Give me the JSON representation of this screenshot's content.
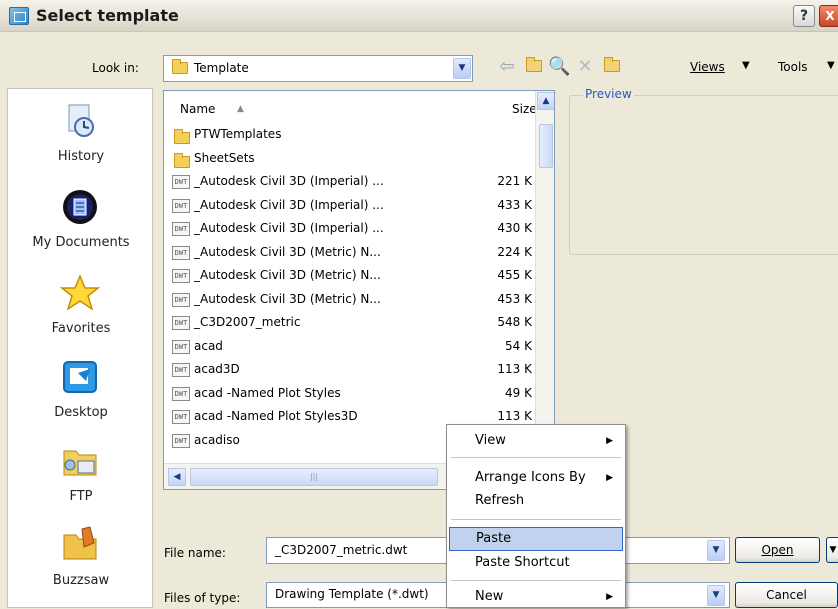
{
  "window": {
    "title": "Select template",
    "help_label": "?",
    "close_label": "X"
  },
  "lookin": {
    "label": "Look in:",
    "value": "Template"
  },
  "toolbar": {
    "views_label": "Views",
    "tools_label": "Tools"
  },
  "places": [
    {
      "label": "History",
      "icon": "history-icon"
    },
    {
      "label": "My Documents",
      "icon": "my-documents-icon"
    },
    {
      "label": "Favorites",
      "icon": "favorites-icon"
    },
    {
      "label": "Desktop",
      "icon": "desktop-icon"
    },
    {
      "label": "FTP",
      "icon": "ftp-icon"
    },
    {
      "label": "Buzzsaw",
      "icon": "buzzsaw-icon"
    }
  ],
  "filelist": {
    "columns": {
      "name": "Name",
      "size": "Size"
    },
    "items": [
      {
        "type": "folder",
        "name": "PTWTemplates",
        "size": ""
      },
      {
        "type": "folder",
        "name": "SheetSets",
        "size": ""
      },
      {
        "type": "dwt",
        "name": "_Autodesk Civil 3D (Imperial) ...",
        "size": "221 K"
      },
      {
        "type": "dwt",
        "name": "_Autodesk Civil 3D (Imperial) ...",
        "size": "433 K"
      },
      {
        "type": "dwt",
        "name": "_Autodesk Civil 3D (Imperial) ...",
        "size": "430 K"
      },
      {
        "type": "dwt",
        "name": "_Autodesk Civil 3D (Metric) N...",
        "size": "224 K"
      },
      {
        "type": "dwt",
        "name": "_Autodesk Civil 3D (Metric) N...",
        "size": "455 K"
      },
      {
        "type": "dwt",
        "name": "_Autodesk Civil 3D (Metric) N...",
        "size": "453 K"
      },
      {
        "type": "dwt",
        "name": "_C3D2007_metric",
        "size": "548 K"
      },
      {
        "type": "dwt",
        "name": "acad",
        "size": "54 K"
      },
      {
        "type": "dwt",
        "name": "acad3D",
        "size": "113 K"
      },
      {
        "type": "dwt",
        "name": "acad -Named Plot Styles",
        "size": "49 K"
      },
      {
        "type": "dwt",
        "name": "acad -Named Plot Styles3D",
        "size": "113 K"
      },
      {
        "type": "dwt",
        "name": "acadiso",
        "size": ""
      }
    ],
    "dwt_badge": "DWT"
  },
  "preview": {
    "label": "Preview"
  },
  "filename": {
    "label": "File name:",
    "value": "_C3D2007_metric.dwt"
  },
  "filetype": {
    "label": "Files of type:",
    "value": "Drawing Template (*.dwt)"
  },
  "buttons": {
    "open": "Open",
    "cancel": "Cancel"
  },
  "context_menu": {
    "items": [
      {
        "label": "View",
        "submenu": true,
        "highlighted": false
      },
      {
        "label": "Arrange Icons By",
        "submenu": true,
        "highlighted": false
      },
      {
        "label": "Refresh",
        "submenu": false,
        "highlighted": false
      },
      {
        "label": "Paste",
        "submenu": false,
        "highlighted": true
      },
      {
        "label": "Paste Shortcut",
        "submenu": false,
        "highlighted": false
      },
      {
        "label": "New",
        "submenu": true,
        "highlighted": false
      }
    ]
  }
}
